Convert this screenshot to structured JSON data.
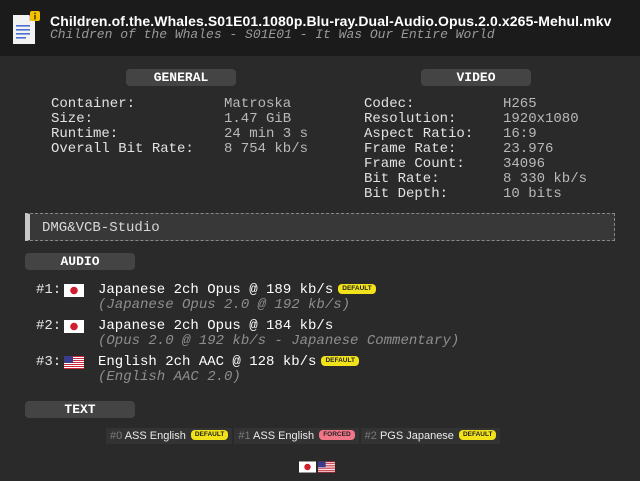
{
  "header": {
    "filename": "Children.of.the.Whales.S01E01.1080p.Blu-ray.Dual-Audio.Opus.2.0.x265-Mehul.mkv",
    "subtitle": "Children of the Whales - S01E01 - It Was Our Entire World",
    "icon": "file-info-icon"
  },
  "general": {
    "title": "GENERAL",
    "rows": [
      {
        "label": "Container:",
        "value": "Matroska"
      },
      {
        "label": "Size:",
        "value": "1.47 GiB"
      },
      {
        "label": "Runtime:",
        "value": "24 min 3 s"
      },
      {
        "label": "Overall Bit Rate:",
        "value": "8 754 kb/s"
      }
    ]
  },
  "video": {
    "title": "VIDEO",
    "rows": [
      {
        "label": "Codec:",
        "value": "H265"
      },
      {
        "label": "Resolution:",
        "value": "1920x1080"
      },
      {
        "label": "Aspect Ratio:",
        "value": "16:9"
      },
      {
        "label": "Frame Rate:",
        "value": "23.976"
      },
      {
        "label": "Frame Count:",
        "value": "34096"
      },
      {
        "label": "Bit Rate:",
        "value": "8 330 kb/s"
      },
      {
        "label": "Bit Depth:",
        "value": "10 bits"
      }
    ]
  },
  "studio": "DMG&VCB-Studio",
  "audio": {
    "title": "AUDIO",
    "tracks": [
      {
        "num": "#1:",
        "flag": "japan-flag-icon",
        "title": "Japanese 2ch Opus @ 189 kb/s",
        "badge": "DEFAULT",
        "sub": "(Japanese Opus 2.0 @ 192 kb/s)"
      },
      {
        "num": "#2:",
        "flag": "japan-flag-icon",
        "title": "Japanese 2ch Opus @ 184 kb/s",
        "badge": "",
        "sub": "(Opus 2.0 @ 192 kb/s - Japanese Commentary)"
      },
      {
        "num": "#3:",
        "flag": "us-flag-icon",
        "title": "English 2ch AAC @ 128 kb/s",
        "badge": "DEFAULT",
        "sub": "(English AAC 2.0)"
      }
    ]
  },
  "text": {
    "title": "TEXT",
    "subs": [
      {
        "idx": "#0",
        "name": "ASS English",
        "badge": "DEFAULT"
      },
      {
        "idx": "#1",
        "name": "ASS English",
        "badge": "FORCED"
      },
      {
        "idx": "#2",
        "name": "PGS Japanese",
        "badge": "DEFAULT"
      }
    ]
  },
  "footer_flags": [
    "japan-flag-icon",
    "us-flag-icon"
  ],
  "colors": {
    "background": "#2a2a2a",
    "header_bg": "#1b1b1b",
    "badge_default": "#f2e21a",
    "badge_forced": "#f07688"
  }
}
